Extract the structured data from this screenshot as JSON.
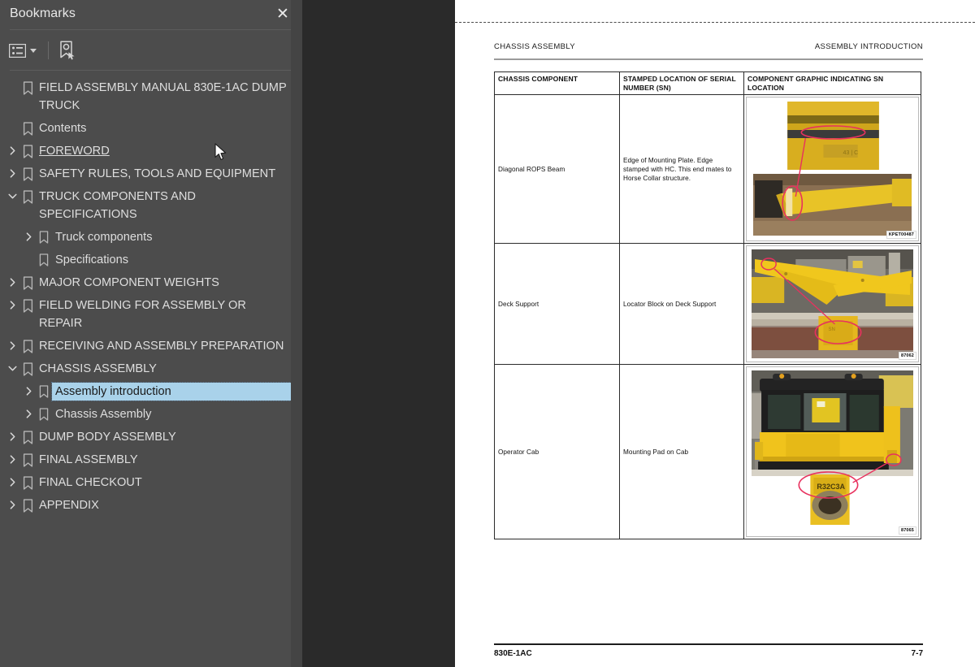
{
  "sidebar": {
    "title": "Bookmarks",
    "close_label": "✕",
    "toolbar": {
      "options_icon": "list-options-icon",
      "options_caret": "chevron-down-icon",
      "find_bookmark_icon": "find-current-bookmark-icon"
    },
    "items": [
      {
        "label": "FIELD ASSEMBLY MANUAL 830E-1AC DUMP TRUCK",
        "level": 0,
        "twisty": "none",
        "selected": false,
        "underline": false
      },
      {
        "label": "Contents",
        "level": 0,
        "twisty": "none",
        "selected": false,
        "underline": false
      },
      {
        "label": "FOREWORD",
        "level": 0,
        "twisty": "collapsed",
        "selected": false,
        "underline": true
      },
      {
        "label": "SAFETY RULES, TOOLS AND EQUIPMENT",
        "level": 0,
        "twisty": "collapsed",
        "selected": false,
        "underline": false
      },
      {
        "label": "TRUCK COMPONENTS AND SPECIFICATIONS",
        "level": 0,
        "twisty": "expanded",
        "selected": false,
        "underline": false
      },
      {
        "label": "Truck components",
        "level": 1,
        "twisty": "collapsed",
        "selected": false,
        "underline": false
      },
      {
        "label": "Specifications",
        "level": 1,
        "twisty": "none",
        "selected": false,
        "underline": false
      },
      {
        "label": "MAJOR COMPONENT WEIGHTS",
        "level": 0,
        "twisty": "collapsed",
        "selected": false,
        "underline": false
      },
      {
        "label": "FIELD WELDING FOR ASSEMBLY OR REPAIR",
        "level": 0,
        "twisty": "collapsed",
        "selected": false,
        "underline": false
      },
      {
        "label": "RECEIVING AND ASSEMBLY PREPARATION",
        "level": 0,
        "twisty": "collapsed",
        "selected": false,
        "underline": false
      },
      {
        "label": "CHASSIS ASSEMBLY",
        "level": 0,
        "twisty": "expanded",
        "selected": false,
        "underline": false
      },
      {
        "label": "Assembly introduction",
        "level": 1,
        "twisty": "collapsed",
        "selected": true,
        "underline": false
      },
      {
        "label": "Chassis Assembly",
        "level": 1,
        "twisty": "collapsed",
        "selected": false,
        "underline": false
      },
      {
        "label": "DUMP BODY ASSEMBLY",
        "level": 0,
        "twisty": "collapsed",
        "selected": false,
        "underline": false
      },
      {
        "label": "FINAL ASSEMBLY",
        "level": 0,
        "twisty": "collapsed",
        "selected": false,
        "underline": false
      },
      {
        "label": "FINAL CHECKOUT",
        "level": 0,
        "twisty": "collapsed",
        "selected": false,
        "underline": false
      },
      {
        "label": "APPENDIX",
        "level": 0,
        "twisty": "collapsed",
        "selected": false,
        "underline": false
      }
    ]
  },
  "collapse_handle_icon": "triangle-left-icon",
  "document": {
    "header_left": "CHASSIS ASSEMBLY",
    "header_right": "ASSEMBLY INTRODUCTION",
    "footer_left": "830E-1AC",
    "footer_right": "7-7",
    "table": {
      "headers": [
        "CHASSIS COMPONENT",
        "STAMPED LOCATION OF SERIAL NUMBER (SN)",
        "COMPONENT GRAPHIC INDICATING SN LOCATION"
      ],
      "rows": [
        {
          "component": "Diagonal ROPS Beam",
          "location": "Edge of Mounting Plate. Edge stamped with HC. This end mates to Horse Collar structure.",
          "figure_id": "KPET00487"
        },
        {
          "component": "Deck Support",
          "location": "Locator Block on Deck Support",
          "figure_id": "87062"
        },
        {
          "component": "Operator Cab",
          "location": "Mounting Pad on Cab",
          "figure_id": "87065"
        }
      ]
    }
  },
  "colors": {
    "sidebar_bg": "#4c4c4c",
    "viewer_bg": "#2a2a2a",
    "page_bg": "#ffffff",
    "selection": "#a9d2ea",
    "highlight_ellipse": "#e8315e",
    "machine_yellow": "#f2c319"
  }
}
